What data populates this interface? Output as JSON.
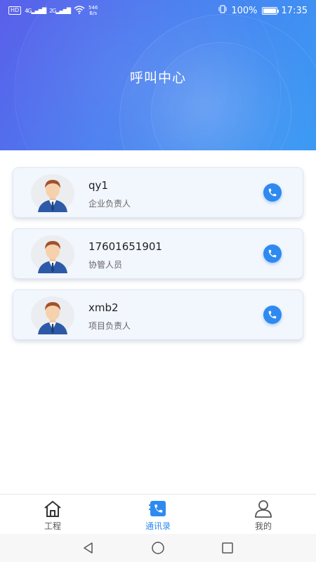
{
  "status_bar": {
    "network_tags": [
      "HD",
      "HD"
    ],
    "signal_labels": [
      "4G",
      "2G"
    ],
    "speed_value": "546",
    "speed_unit": "B/s",
    "battery_percent": "100%",
    "battery_level": 1.0,
    "time": "17:35"
  },
  "header": {
    "title": "呼叫中心"
  },
  "contacts": [
    {
      "name": "qy1",
      "role": "企业负责人"
    },
    {
      "name": "17601651901",
      "role": "协管人员"
    },
    {
      "name": "xmb2",
      "role": "项目负责人"
    }
  ],
  "tabs": [
    {
      "label": "工程",
      "icon": "home-icon",
      "active": false
    },
    {
      "label": "通讯录",
      "icon": "contacts-phone-icon",
      "active": true
    },
    {
      "label": "我的",
      "icon": "user-icon",
      "active": false
    }
  ],
  "colors": {
    "accent": "#2f8af0",
    "header_start": "#5a5fea",
    "header_end": "#3a9bf4"
  }
}
